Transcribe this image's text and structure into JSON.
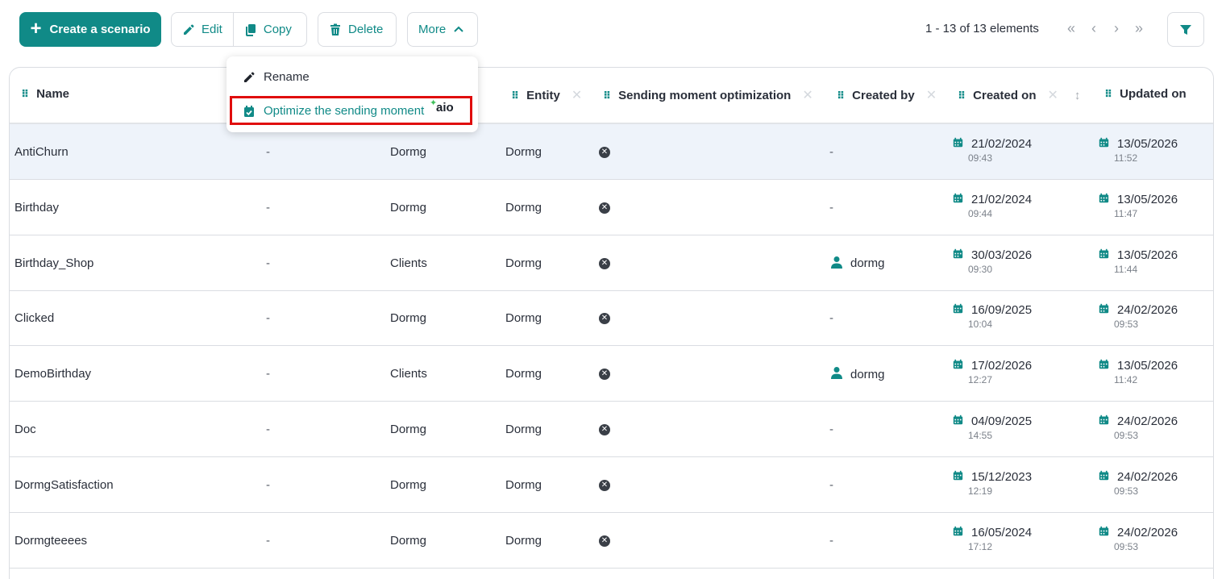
{
  "toolbar": {
    "create_label": "Create a scenario",
    "edit_label": "Edit",
    "copy_label": "Copy",
    "delete_label": "Delete",
    "more_label": "More",
    "pager_text": "1 - 13 of 13 elements",
    "accent_color": "#108a87"
  },
  "more_menu": {
    "rename_label": "Rename",
    "optimize_label": "Optimize the sending moment",
    "aio_badge": "aio"
  },
  "columns": {
    "name": "Name",
    "entity": "Entity",
    "sending": "Sending moment optimization",
    "created_by": "Created by",
    "created_on": "Created on",
    "updated_on": "Updated on"
  },
  "rows": [
    {
      "name": "AntiChurn",
      "c2": "-",
      "c3": "Dormg",
      "entity": "Dormg",
      "created_by": "-",
      "created_date": "21/02/2024",
      "created_time": "09:43",
      "updated_date": "13/05/2026",
      "updated_time": "11:52"
    },
    {
      "name": "Birthday",
      "c2": "-",
      "c3": "Dormg",
      "entity": "Dormg",
      "created_by": "-",
      "created_date": "21/02/2024",
      "created_time": "09:44",
      "updated_date": "13/05/2026",
      "updated_time": "11:47"
    },
    {
      "name": "Birthday_Shop",
      "c2": "-",
      "c3": "Clients",
      "entity": "Dormg",
      "created_by": "dormg",
      "created_date": "30/03/2026",
      "created_time": "09:30",
      "updated_date": "13/05/2026",
      "updated_time": "11:44"
    },
    {
      "name": "Clicked",
      "c2": "-",
      "c3": "Dormg",
      "entity": "Dormg",
      "created_by": "-",
      "created_date": "16/09/2025",
      "created_time": "10:04",
      "updated_date": "24/02/2026",
      "updated_time": "09:53"
    },
    {
      "name": "DemoBirthday",
      "c2": "-",
      "c3": "Clients",
      "entity": "Dormg",
      "created_by": "dormg",
      "created_date": "17/02/2026",
      "created_time": "12:27",
      "updated_date": "13/05/2026",
      "updated_time": "11:42"
    },
    {
      "name": "Doc",
      "c2": "-",
      "c3": "Dormg",
      "entity": "Dormg",
      "created_by": "-",
      "created_date": "04/09/2025",
      "created_time": "14:55",
      "updated_date": "24/02/2026",
      "updated_time": "09:53"
    },
    {
      "name": "DormgSatisfaction",
      "c2": "-",
      "c3": "Dormg",
      "entity": "Dormg",
      "created_by": "-",
      "created_date": "15/12/2023",
      "created_time": "12:19",
      "updated_date": "24/02/2026",
      "updated_time": "09:53"
    },
    {
      "name": "Dormgteeees",
      "c2": "-",
      "c3": "Dormg",
      "entity": "Dormg",
      "created_by": "-",
      "created_date": "16/05/2024",
      "created_time": "17:12",
      "updated_date": "24/02/2026",
      "updated_time": "09:53"
    }
  ]
}
